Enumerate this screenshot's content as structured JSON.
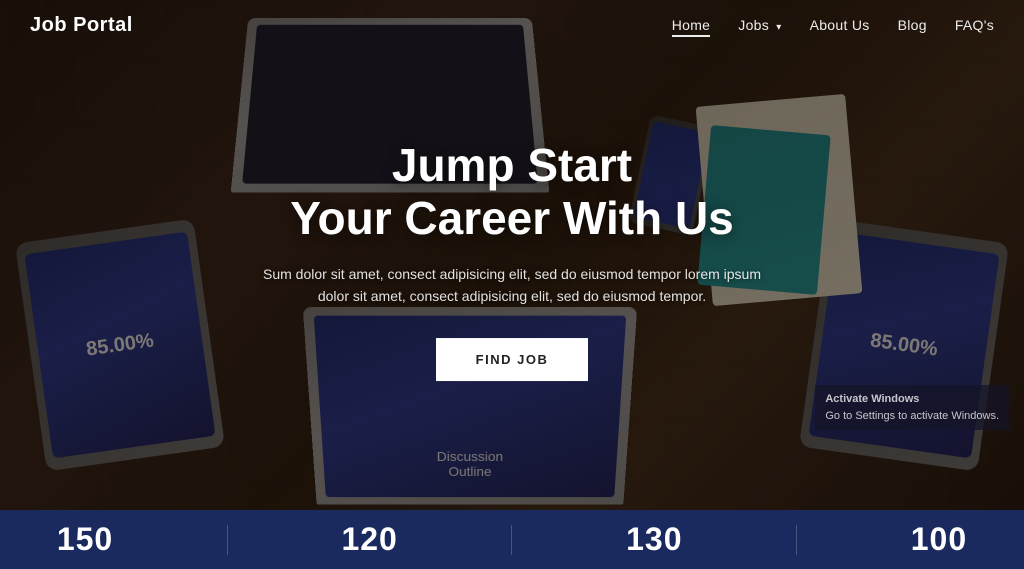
{
  "brand": {
    "logo": "Job Portal"
  },
  "nav": {
    "links": [
      {
        "label": "Home",
        "active": true,
        "has_dropdown": false
      },
      {
        "label": "Jobs",
        "active": false,
        "has_dropdown": true
      },
      {
        "label": "About Us",
        "active": false,
        "has_dropdown": false
      },
      {
        "label": "Blog",
        "active": false,
        "has_dropdown": false
      },
      {
        "label": "FAQ's",
        "active": false,
        "has_dropdown": false
      }
    ]
  },
  "hero": {
    "title_line1": "Jump Start",
    "title_line2": "Your Career With Us",
    "subtitle": "Sum dolor sit amet, consect adipisicing elit, sed do eiusmod tempor lorem ipsum dolor sit amet, consect adipisicing elit, sed do eiusmod tempor.",
    "cta_label": "FIND JOB"
  },
  "stats": [
    {
      "value": "150"
    },
    {
      "value": "120"
    },
    {
      "value": "130"
    },
    {
      "value": "100"
    }
  ],
  "devices": {
    "tablet_left_text": "85.00%",
    "tablet_right_text": "85.00%",
    "laptop_bottom_text": "Discussion\nOutline"
  },
  "windows_notice": {
    "line1": "Activate Windows",
    "line2": "Go to Settings to activate Windows."
  }
}
